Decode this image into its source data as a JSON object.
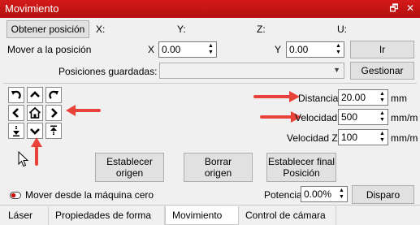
{
  "window": {
    "title": "Movimiento"
  },
  "header": {
    "get_position_label": "Obtener posición",
    "x_label": "X:",
    "y_label": "Y:",
    "z_label": "Z:",
    "u_label": "U:"
  },
  "move_to": {
    "label": "Mover a la posición",
    "x_label": "X",
    "x_value": "0.00",
    "y_label": "Y",
    "y_value": "0.00",
    "go_label": "Ir"
  },
  "saved": {
    "label": "Posiciones guardadas:",
    "selected": "",
    "manage_label": "Gestionar"
  },
  "params": {
    "distance_label": "Distancia",
    "distance_value": "20.00",
    "distance_unit": "mm",
    "speed_label": "Velocidad",
    "speed_value": "500",
    "speed_unit": "mm/m",
    "speedz_label": "Velocidad Z",
    "speedz_value": "100",
    "speedz_unit": "mm/m"
  },
  "origin_buttons": {
    "set_origin": "Establecer\norigen",
    "clear_origin": "Borrar\norigen",
    "set_final": "Establecer final\nPosición"
  },
  "bottom": {
    "move_from_zero_label": "Mover desde la máquina cero",
    "move_from_zero_checked": false,
    "power_label": "Potencia",
    "power_value": "0.00%",
    "laser_button": "Disparo"
  },
  "tabs": [
    {
      "label": "Láser",
      "active": false
    },
    {
      "label": "Propiedades de forma",
      "active": false
    },
    {
      "label": "Movimiento",
      "active": true
    },
    {
      "label": "Control de cámara",
      "active": false
    }
  ],
  "colors": {
    "titlebar": "#c41515",
    "annotation_arrows": "#e8423a"
  },
  "icons": {
    "jog": [
      "rotate-ccw-icon",
      "arrow-up-icon",
      "rotate-cw-icon",
      "arrow-left-icon",
      "home-icon",
      "arrow-right-icon",
      "z-down-icon",
      "arrow-down-icon",
      "z-up-icon"
    ]
  }
}
